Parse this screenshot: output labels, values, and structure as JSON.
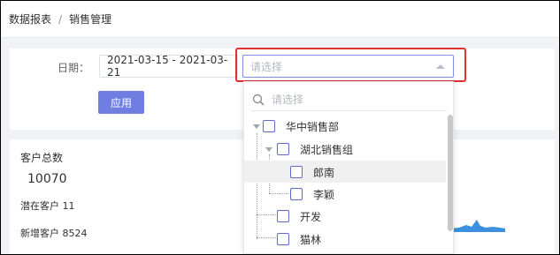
{
  "breadcrumb": {
    "root": "数据报表",
    "separator": "/",
    "current": "销售管理"
  },
  "filter": {
    "date_label": "日期：",
    "date_value": "2021-03-15 - 2021-03-21",
    "select_placeholder": "请选择",
    "apply_label": "应用"
  },
  "dropdown": {
    "search_placeholder": "请选择",
    "nodes": [
      {
        "label": "华中销售部",
        "level": 0
      },
      {
        "label": "湖北销售组",
        "level": 1
      },
      {
        "label": "郎南",
        "level": 2
      },
      {
        "label": "李颖",
        "level": 2
      },
      {
        "label": "开发",
        "level": 1
      },
      {
        "label": "猫林",
        "level": 1
      }
    ]
  },
  "stats": {
    "title": "客户总数",
    "total": "10070",
    "potential": "潜在客户 11",
    "new": "新增客户 8524"
  },
  "colors": {
    "accent": "#6f7ee0",
    "highlight": "#e03030",
    "chart": "#3d8fe0"
  }
}
